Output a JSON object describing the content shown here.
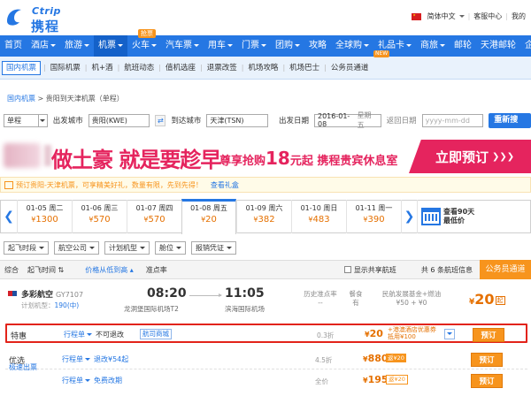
{
  "header": {
    "logo_en": "Ctrip",
    "logo_cn": "携程",
    "lang": "简体中文",
    "service": "客服中心",
    "mine": "我的"
  },
  "nav": {
    "items": [
      "首页",
      "酒店",
      "旅游",
      "机票",
      "火车",
      "汽车票",
      "用车",
      "门票",
      "团购",
      "攻略",
      "全球购",
      "礼品卡",
      "商旅",
      "邮轮",
      "天港邮轮",
      "企"
    ],
    "badge_new": "抢票",
    "badge_gift": "NEW"
  },
  "subnav": {
    "items": [
      "国内机票",
      "国际机票",
      "机+酒",
      "航班动态",
      "值机选座",
      "退票改签",
      "机场攻略",
      "机场巴士",
      "公务员通道"
    ],
    "badge": "NEW"
  },
  "breadcrumb": {
    "root": "国内机票",
    "sep": ">",
    "current": "贵阳到天津机票（单程）"
  },
  "search": {
    "trip_type": "单程",
    "depart_label": "出发城市",
    "depart_value": "贵阳(KWE)",
    "arrive_label": "到达城市",
    "arrive_value": "天津(TSN)",
    "date_label": "出发日期",
    "date_value": "2016-01-08",
    "weekday": "星期五",
    "return_label": "返回日期",
    "return_placeholder": "yyyy-mm-dd",
    "search_btn": "重新搜索"
  },
  "banner": {
    "main": "做土豪 就是要趁早",
    "sub_prefix": "尊享抢购",
    "sub_big": "18",
    "sub_suffix": "元起 携程贵宾休息室",
    "cta": "立即预订"
  },
  "notice": {
    "text": "预订贵阳-天津机票，可享精美好礼，数量有限，先到先得！",
    "link": "查看礼盒"
  },
  "dates": [
    {
      "date": "01-05 周二",
      "price": "1300"
    },
    {
      "date": "01-06 周三",
      "price": "570"
    },
    {
      "date": "01-07 周四",
      "price": "570"
    },
    {
      "date": "01-08 周五",
      "price": "20"
    },
    {
      "date": "01-09 周六",
      "price": "382"
    },
    {
      "date": "01-10 周日",
      "price": "483"
    },
    {
      "date": "01-11 周一",
      "price": "390"
    }
  ],
  "calendar": {
    "line1": "查看90天",
    "line2": "最低价"
  },
  "currency": "¥",
  "filters": [
    "起飞时段",
    "航空公司",
    "计划机型",
    "舱位",
    "报销凭证"
  ],
  "sortbar": {
    "items": [
      "综合",
      "起飞时间",
      "价格从低到高",
      "准点率"
    ],
    "show_shared": "显示共享航班",
    "count_text": "共 6 条航班信息",
    "gov": "公务员通道"
  },
  "flight": {
    "airline": "多彩航空",
    "code": "GY7107",
    "plane_prefix": "计划机型：",
    "plane": "190(中)",
    "dep_time": "08:20",
    "dep_airport": "龙洞堡国际机场T2",
    "arr_time": "11:05",
    "arr_airport": "滨海国际机场",
    "ontime_label": "历史准点率",
    "ontime_val": "--",
    "meal_label": "餐食",
    "meal_val": "有",
    "tax_label": "民航发展基金+燃油",
    "tax_val": "¥50 + ¥0",
    "lowest": "20",
    "lowest_suffix": "起"
  },
  "fares": [
    {
      "label": "特惠",
      "label2": "",
      "rule": "行程单",
      "refund": "不可退改",
      "tag": "航司商城",
      "discount": "0.3折",
      "price": "20",
      "hotel_line1": "+港澳酒店优惠券",
      "hotel_line2": "抵用¥100",
      "action": "预订"
    },
    {
      "label": "优选",
      "label2": "极速出票",
      "rule": "行程单",
      "refund": "退改¥54起",
      "tag": "",
      "discount": "4.5折",
      "price": "880",
      "badge": "返¥20",
      "action": "预订"
    },
    {
      "label": "",
      "label2": "",
      "rule": "行程单",
      "refund": "免费改期",
      "tag": "",
      "discount": "全价",
      "price": "1950",
      "badge": "返¥20",
      "action": "预订"
    }
  ],
  "colors": {
    "brand": "#2577e3",
    "accent": "#f7941d",
    "price": "#e57000",
    "banner": "#e5245e"
  }
}
